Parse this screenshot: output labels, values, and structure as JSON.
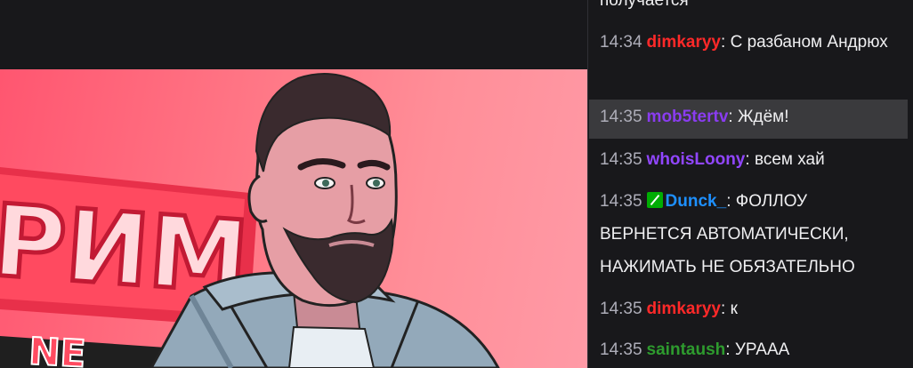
{
  "chat": {
    "messages": [
      {
        "timestamp": "",
        "user": "",
        "user_color": "#efeff1",
        "text": "получается",
        "highlight": false,
        "badge": null
      },
      {
        "timestamp": "14:34",
        "user": "dimkaryy",
        "user_color": "#ff2929",
        "text": "С разбаном Андрюх",
        "highlight": false,
        "badge": null
      },
      {
        "timestamp": "14:35",
        "user": "mob5tertv",
        "user_color": "#8a3cf0",
        "text": "Ждём!",
        "highlight": true,
        "badge": null
      },
      {
        "timestamp": "14:35",
        "user": "whoisLoony",
        "user_color": "#9146ff",
        "text": "всем хай",
        "highlight": false,
        "badge": null
      },
      {
        "timestamp": "14:35",
        "user": "Dunck_",
        "user_color": "#1e90ff",
        "text": "ФОЛЛОУ ВЕРНЕТСЯ АВТОМАТИЧЕСКИ, НАЖИМАТЬ НЕ ОБЯЗАТЕЛЬНО",
        "highlight": false,
        "badge": "moderator-sword-icon"
      },
      {
        "timestamp": "14:35",
        "user": "dimkaryy",
        "user_color": "#ff2929",
        "text": "к",
        "highlight": false,
        "badge": null
      },
      {
        "timestamp": "14:35",
        "user": "saintaush",
        "user_color": "#2e9b2e",
        "text": "УРААА",
        "highlight": false,
        "badge": null
      }
    ]
  },
  "stream_overlay": {
    "visible_text_fragment": "РИМ",
    "bottom_text_fragment": "NE"
  },
  "colors": {
    "background": "#18181b",
    "timestamp": "#adadb8",
    "highlight_row": "#3a3a3d",
    "mod_badge": "#00ad03"
  }
}
